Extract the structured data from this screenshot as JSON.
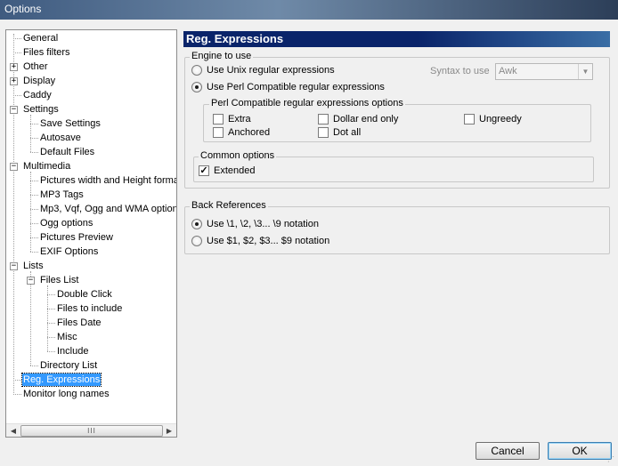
{
  "window": {
    "title": "Options"
  },
  "tree": {
    "nodes": [
      {
        "label": "General"
      },
      {
        "label": "Files filters"
      },
      {
        "label": "Other",
        "expander": "+"
      },
      {
        "label": "Display",
        "expander": "+"
      },
      {
        "label": "Caddy"
      },
      {
        "label": "Settings",
        "expander": "−"
      },
      {
        "label": "Save Settings"
      },
      {
        "label": "Autosave"
      },
      {
        "label": "Default Files"
      },
      {
        "label": "Multimedia",
        "expander": "−"
      },
      {
        "label": "Pictures width and Height format"
      },
      {
        "label": "MP3 Tags"
      },
      {
        "label": "Mp3, Vqf, Ogg and WMA option"
      },
      {
        "label": "Ogg options"
      },
      {
        "label": "Pictures Preview"
      },
      {
        "label": "EXIF Options"
      },
      {
        "label": "Lists",
        "expander": "−"
      },
      {
        "label": "Files List",
        "expander": "−"
      },
      {
        "label": "Double Click"
      },
      {
        "label": "Files to include"
      },
      {
        "label": "Files Date"
      },
      {
        "label": "Misc"
      },
      {
        "label": "Include"
      },
      {
        "label": "Directory List"
      },
      {
        "label": "Reg. Expressions",
        "selected": true
      },
      {
        "label": "Monitor long names"
      }
    ],
    "scroll_left": "◀",
    "scroll_right": "▶",
    "scroll_grip": "III"
  },
  "panel": {
    "title": "Reg. Expressions",
    "engine": {
      "legend": "Engine to use",
      "unix_label": "Use Unix regular expressions",
      "perl_label": "Use Perl Compatible regular expressions",
      "selected": "perl",
      "syntax_label": "Syntax to use",
      "syntax_value": "Awk",
      "syntax_arrow": "▼"
    },
    "pcre_options": {
      "legend": "Perl Compatible regular expressions options",
      "extra": {
        "label": "Extra",
        "checked": false
      },
      "dollar_end_only": {
        "label": "Dollar end only",
        "checked": false
      },
      "ungreedy": {
        "label": "Ungreedy",
        "checked": false
      },
      "anchored": {
        "label": "Anchored",
        "checked": false
      },
      "dot_all": {
        "label": "Dot all",
        "checked": false
      }
    },
    "common_options": {
      "legend": "Common options",
      "extended": {
        "label": "Extended",
        "checked": true,
        "mark": "✓"
      }
    },
    "back_references": {
      "legend": "Back References",
      "backslash_label": "Use \\1, \\2, \\3... \\9 notation",
      "dollar_label": "Use $1, $2, $3... $9 notation",
      "selected": "backslash"
    }
  },
  "buttons": {
    "cancel": "Cancel",
    "ok": "OK"
  }
}
